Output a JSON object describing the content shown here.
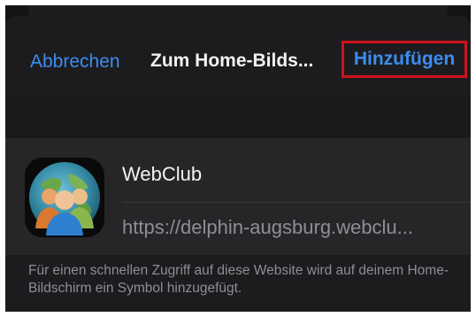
{
  "navbar": {
    "cancel_label": "Abbrechen",
    "title": "Zum Home-Bilds...",
    "add_label": "Hinzufügen"
  },
  "app": {
    "icon": "webclub-people-globe-icon",
    "name": "WebClub",
    "url": "https://delphin-augsburg.webclu..."
  },
  "footnote": "Für einen schnellen Zugriff auf diese Website wird auf deinem Home-Bildschirm ein Symbol hinzugefügt.",
  "colors": {
    "accent": "#3b8df0",
    "highlight_box": "#d0121b",
    "background": "#1c1c1e",
    "card": "#262628"
  }
}
